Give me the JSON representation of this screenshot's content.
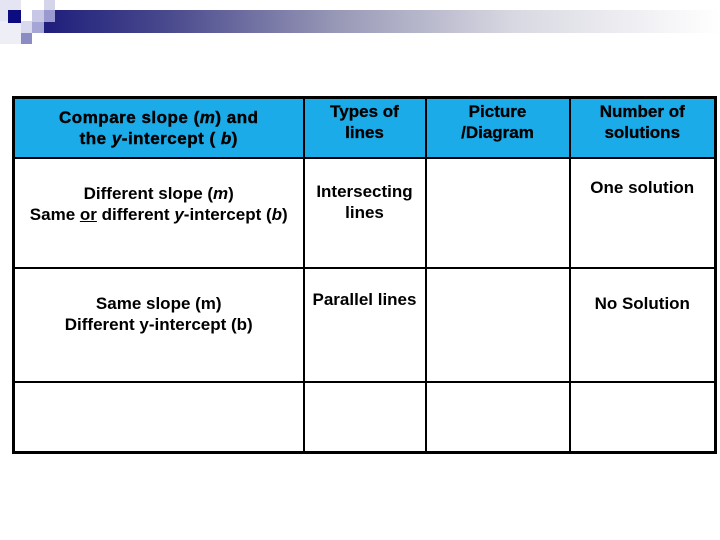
{
  "slide": {
    "accent_colors": {
      "header_fill": "#1aabe8",
      "bar_start": "#1a1a7a",
      "bar_end": "#ffffff",
      "border": "#000000"
    }
  },
  "table": {
    "headers": {
      "col1": {
        "line1_pre": "Compare slope (",
        "line1_var": "m",
        "line1_post": ") and",
        "line2_pre": "the ",
        "line2_var": "y",
        "line2_mid": "-intercept ( ",
        "line2_var2": "b",
        "line2_post": ")"
      },
      "col2": {
        "line1": "Types of",
        "line2": "lines"
      },
      "col3": {
        "line1": "Picture",
        "line2": "/Diagram"
      },
      "col4": {
        "line1": "Number of",
        "line2": "solutions"
      }
    },
    "rows": [
      {
        "condition": {
          "line1_pre": "Different slope (",
          "line1_var": "m",
          "line1_post": ")",
          "line2_pre": "Same ",
          "line2_underlined": "or",
          "line2_mid": " different ",
          "line2_var": "y",
          "line2_mid2": "-intercept (",
          "line2_var2": "b",
          "line2_post": ")"
        },
        "type_line1": "Intersecting",
        "type_line2": "lines",
        "picture": "",
        "solutions": "One solution"
      },
      {
        "condition": {
          "line1": "Same slope (m)",
          "line2": "Different y-intercept (b)"
        },
        "type": "Parallel lines",
        "picture": "",
        "solutions": "No Solution"
      },
      {
        "condition": "",
        "type": "",
        "picture": "",
        "solutions": ""
      }
    ]
  }
}
